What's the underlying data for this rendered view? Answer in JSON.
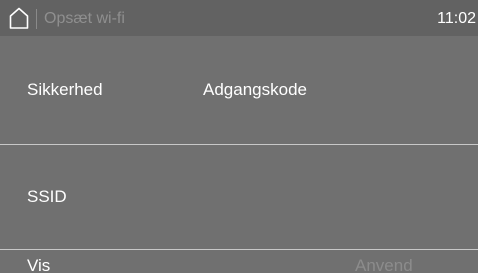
{
  "header": {
    "title": "Opsæt wi-fi",
    "time": "11:02",
    "home_icon": "home-icon"
  },
  "rows": {
    "security_label": "Sikkerhed",
    "password_label": "Adgangskode",
    "ssid_label": "SSID"
  },
  "footer": {
    "show_label": "Vis",
    "apply_label": "Anvend"
  },
  "colors": {
    "panel_bg": "#707070",
    "header_bg": "#626262",
    "text": "#ffffff",
    "disabled_text": "#8c8c8c",
    "divider": "#c8c8c8"
  }
}
